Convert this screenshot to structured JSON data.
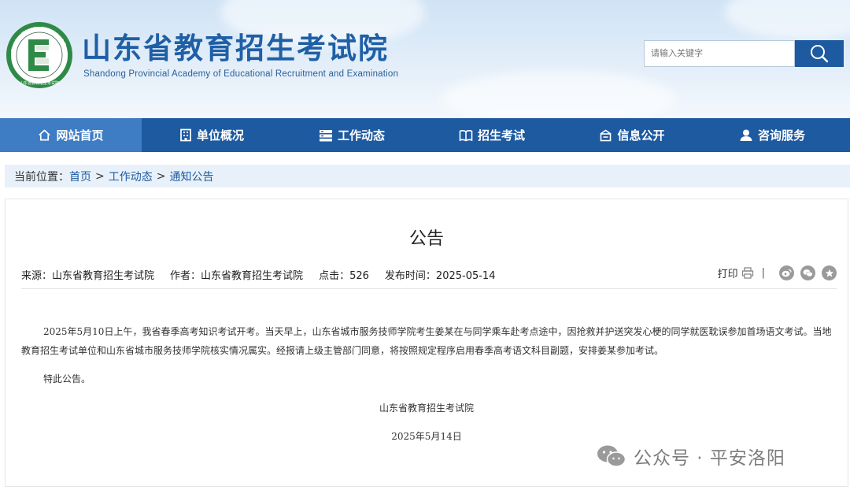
{
  "header": {
    "title": "山东省教育招生考试院",
    "subtitle": "Shandong Provincial Academy of Educational Recruitment and Examination",
    "logo_ring_text": "Shandong Educational Admission & Examination",
    "logo_bottom_text": "山东省教育招生考试院",
    "search_placeholder": "请输入关键字"
  },
  "nav": [
    {
      "label": "网站首页",
      "icon": "home-icon",
      "active": true
    },
    {
      "label": "单位概况",
      "icon": "building-icon"
    },
    {
      "label": "工作动态",
      "icon": "server-icon"
    },
    {
      "label": "招生考试",
      "icon": "book-icon"
    },
    {
      "label": "信息公开",
      "icon": "door-icon"
    },
    {
      "label": "咨询服务",
      "icon": "user-icon"
    }
  ],
  "breadcrumb": {
    "prefix": "当前位置：",
    "items": [
      "首页",
      "工作动态",
      "通知公告"
    ],
    "separator": ">"
  },
  "article": {
    "title": "公告",
    "meta": {
      "source_label": "来源：",
      "source": "山东省教育招生考试院",
      "author_label": "作者：",
      "author": "山东省教育招生考试院",
      "clicks_label": "点击：",
      "clicks": "526",
      "date_label": "发布时间：",
      "date": "2025-05-14"
    },
    "print_label": "打印",
    "divider": "|",
    "share_icons": [
      "weibo-icon",
      "wechat-icon",
      "qzone-icon"
    ],
    "paragraph1": "2025年5月10日上午，我省春季高考知识考试开考。当天早上，山东省城市服务技师学院考生姜某在与同学乘车赴考点途中，因抢救并护送突发心梗的同学就医耽误参加首场语文考试。当地教育招生考试单位和山东省城市服务技师学院核实情况属实。经报请上级主管部门同意，将按照规定程序启用春季高考语文科目副题，安排姜某参加考试。",
    "paragraph2": "特此公告。",
    "signature": "山东省教育招生考试院",
    "signature_date": "2025年5月14日"
  },
  "watermark": {
    "text": "公众号 · 平安洛阳"
  },
  "colors": {
    "nav_bg": "#1e5aa0",
    "nav_active": "#3e7cc4",
    "title_blue": "#1f5fa6",
    "breadcrumb_bg": "#e8f1fa",
    "logo_green": "#2e8a46"
  }
}
